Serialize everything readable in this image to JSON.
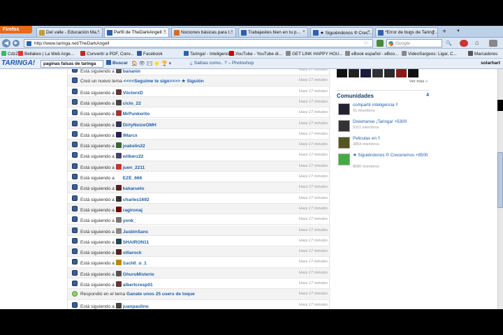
{
  "browser": {
    "firefox_label": "Firefox",
    "tabs": [
      {
        "label": "Del valle - Educación Ma...",
        "color": "#c89a3a"
      },
      {
        "label": "Perfil de TheDarkAngell ...",
        "color": "#2d62a8"
      },
      {
        "label": "Nociones básicas para t...",
        "color": "#e06a1b"
      },
      {
        "label": "Trabajastes bien en tu p...",
        "color": "#2d62a8"
      },
      {
        "label": "★ Siguiéndonos ® Crec...",
        "color": "#2d62a8"
      },
      {
        "label": "*Error de bugs de Taring...",
        "color": "#2d62a8"
      }
    ],
    "url": "http://www.taringa.net/TheDarkAngell",
    "search_placeholder": "Google",
    "bookmarks": [
      {
        "label": "CdzZx",
        "color": "#3b6"
      },
      {
        "label": "Bellakeo | La Web Arge...",
        "color": "#e33"
      },
      {
        "label": "Convertir a PDF, Conv...",
        "color": "#c22"
      },
      {
        "label": "Facebook",
        "color": "#3b5998"
      },
      {
        "label": "Taringa! - Inteligencia ...",
        "color": "#2d62a8"
      },
      {
        "label": "YouTube - YouTube di...",
        "color": "#c00"
      },
      {
        "label": "GET LINK HAPPY HOU...",
        "color": "#888"
      },
      {
        "label": "eBook español - eBoo...",
        "color": "#888"
      },
      {
        "label": "VideoSargeos: Ligar, C...",
        "color": "#888"
      },
      {
        "label": "Marcadores",
        "color": "#555"
      }
    ]
  },
  "taringa": {
    "logo": "TARINGA!",
    "search_value": "paginas falsas de taringa",
    "search_button": "Buscar",
    "toolbar_icons": "🏠 👁 ✉ ⭐ 🏆 ▾",
    "sabias": "¿ Sabías como.. ? – Photoshop",
    "user": "solarhart"
  },
  "feed": {
    "following_prefix": "Está siguiendo a",
    "created_prefix": "Creó un nuevo tema",
    "replied_prefix": "Respondió en el tema",
    "time_label": "Hace 17 minutos",
    "rows": [
      {
        "type": "follow",
        "user": "bananin",
        "time": "Hace 17 minutos"
      },
      {
        "type": "created",
        "user": "<<<<Seguime te sigo>>>> ★ Siguión",
        "time": "Hace 17 minutos"
      },
      {
        "type": "follow",
        "user": "ViictorxD",
        "time": "Hace 17 minutos"
      },
      {
        "type": "follow",
        "user": "ciclo_22",
        "time": "Hace 17 minutos"
      },
      {
        "type": "follow",
        "user": "MrPunkerito",
        "time": "Hace 17 minutos"
      },
      {
        "type": "follow",
        "user": "DirtyNoizeOMH",
        "time": "Hace 17 minutos"
      },
      {
        "type": "follow",
        "user": "IMarcx",
        "time": "Hace 17 minutos"
      },
      {
        "type": "follow",
        "user": "joakelin22",
        "time": "Hace 17 minutos"
      },
      {
        "type": "follow",
        "user": "wilberz22",
        "time": "Hace 17 minutos"
      },
      {
        "type": "follow",
        "user": "juen_2211",
        "time": "Hace 17 minutos"
      },
      {
        "type": "follow",
        "user": "EZE_666",
        "time": "Hace 17 minutos"
      },
      {
        "type": "follow",
        "user": "kakaruelo",
        "time": "Hace 17 minutos"
      },
      {
        "type": "follow",
        "user": "charles1692",
        "time": "Hace 17 minutos"
      },
      {
        "type": "follow",
        "user": "ragironaj",
        "time": "Hace 17 minutos"
      },
      {
        "type": "follow",
        "user": "yonk_",
        "time": "Hace 17 minutos"
      },
      {
        "type": "follow",
        "user": "JasbinSanc",
        "time": "Hace 17 minutos"
      },
      {
        "type": "follow",
        "user": "SHAIRON11",
        "time": "Hace 17 minutos"
      },
      {
        "type": "follow",
        "user": "villarock",
        "time": "Hace 17 minutos"
      },
      {
        "type": "follow",
        "user": "1uch0_o_1",
        "time": "Hace 17 minutos"
      },
      {
        "type": "follow",
        "user": "GhuruMisterio",
        "time": "Hace 17 minutos"
      },
      {
        "type": "follow",
        "user": "albertcresp01",
        "time": "Hace 17 minutos"
      },
      {
        "type": "replied",
        "user": "Ganate unos 25 users de toque",
        "time": "Hace 17 minutos"
      },
      {
        "type": "follow",
        "user": "juanpaulino",
        "time": "Hace 17 minutos"
      }
    ]
  },
  "sidebar": {
    "ver_mas": "Ver más »",
    "communities_title": "Comunidades",
    "communities_count": "4",
    "communities": [
      {
        "name": "compartir inteligencia !!",
        "members": "91 miembros",
        "color": "#223"
      },
      {
        "name": "Diviertanse ¡Taringa! +5300",
        "members": "5311 miembros",
        "color": "#333"
      },
      {
        "name": "Peliculas en !!",
        "members": "3854 miembros",
        "color": "#552"
      },
      {
        "name": "★ Siguiéndonos ® Creceremos +8500",
        "members": "8580 miembros",
        "color": "#4a4"
      }
    ]
  }
}
